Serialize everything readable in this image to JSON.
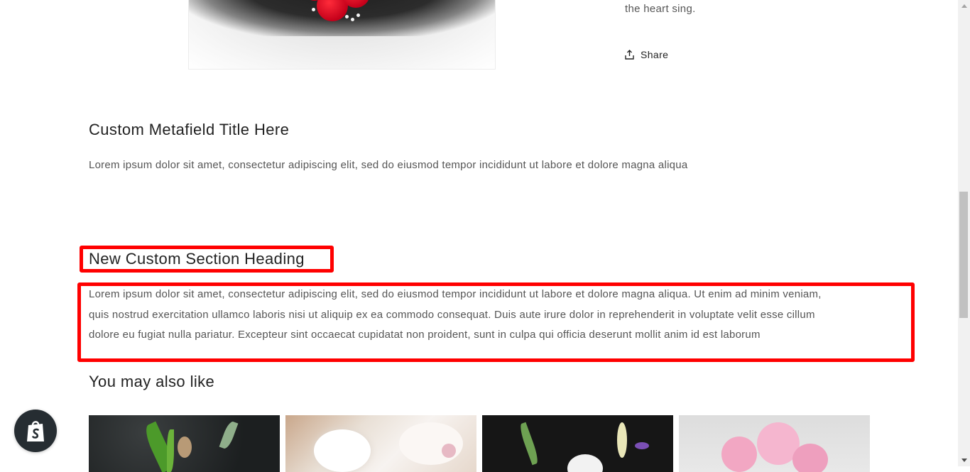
{
  "product": {
    "description_tail": "the heart sing.",
    "share_label": "Share"
  },
  "metafield": {
    "title": "Custom Metafield Title Here",
    "text": "Lorem ipsum dolor sit amet, consectetur adipiscing elit, sed do eiusmod tempor incididunt ut labore et dolore magna aliqua"
  },
  "custom_section": {
    "heading": "New Custom Section Heading",
    "lines": [
      "Lorem ipsum dolor sit amet, consectetur adipiscing elit, sed do eiusmod tempor incididunt ut labore et dolore magna aliqua. Ut enim ad minim veniam,",
      "quis nostrud exercitation ullamco laboris nisi ut aliquip ex ea commodo consequat. Duis aute irure dolor in reprehenderit in voluptate velit esse cillum",
      "dolore eu fugiat nulla pariatur. Excepteur sint occaecat cupidatat non proident, sunt in culpa qui officia deserunt mollit anim id est laborum"
    ],
    "highlight_color": "#ff0000"
  },
  "recommendations": {
    "title": "You may also like"
  },
  "icons": {
    "share": "share-icon",
    "shopify": "shopify-bag-icon"
  }
}
